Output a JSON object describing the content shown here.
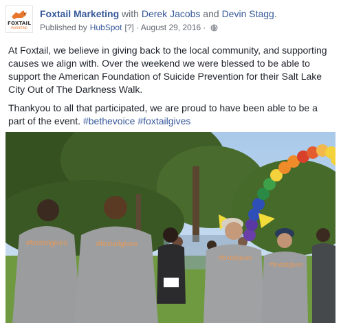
{
  "post": {
    "page_name": "Foxtail Marketing",
    "with_word": " with ",
    "tag_1": "Derek Jacobs",
    "and_word": " and ",
    "tag_2": "Devin Stagg",
    "period": ".",
    "published_by": "Published by",
    "publisher": "HubSpot",
    "publisher_help": "[?]",
    "separator": "·",
    "date": "August 29, 2016",
    "logo_text": "FOXTAIL",
    "logo_subtext": "MARKETING",
    "privacy_icon": "globe-icon"
  },
  "body": {
    "paragraph_1": "At Foxtail, we believe in giving back to the local community, and supporting causes we align with. Over the weekend we were blessed to be able to support the American Foundation of Suicide Prevention for their Salt Lake City Out of The Darkness Walk.",
    "paragraph_2_text": "Thankyou to all that participated, we are proud to have been able to be a part of the event. ",
    "hashtag_1": "#bethevoice",
    "hashtag_2": "#foxtailgives"
  },
  "photo": {
    "shirt_text": "#foxtailgives",
    "colors": {
      "sky": "#bcd6ee",
      "trees": "#3f5e28",
      "grass": "#7fa64a",
      "shirt": "#9a9c9e",
      "balloon_red": "#d8402b",
      "balloon_orange": "#f08b2a",
      "balloon_yellow": "#f4d23c",
      "balloon_blue": "#2e4fb8",
      "balloon_purple": "#6b3fa8"
    }
  },
  "colors": {
    "link": "#365899",
    "text": "#1d2129",
    "muted": "#616770",
    "brand_orange": "#e8772e"
  }
}
